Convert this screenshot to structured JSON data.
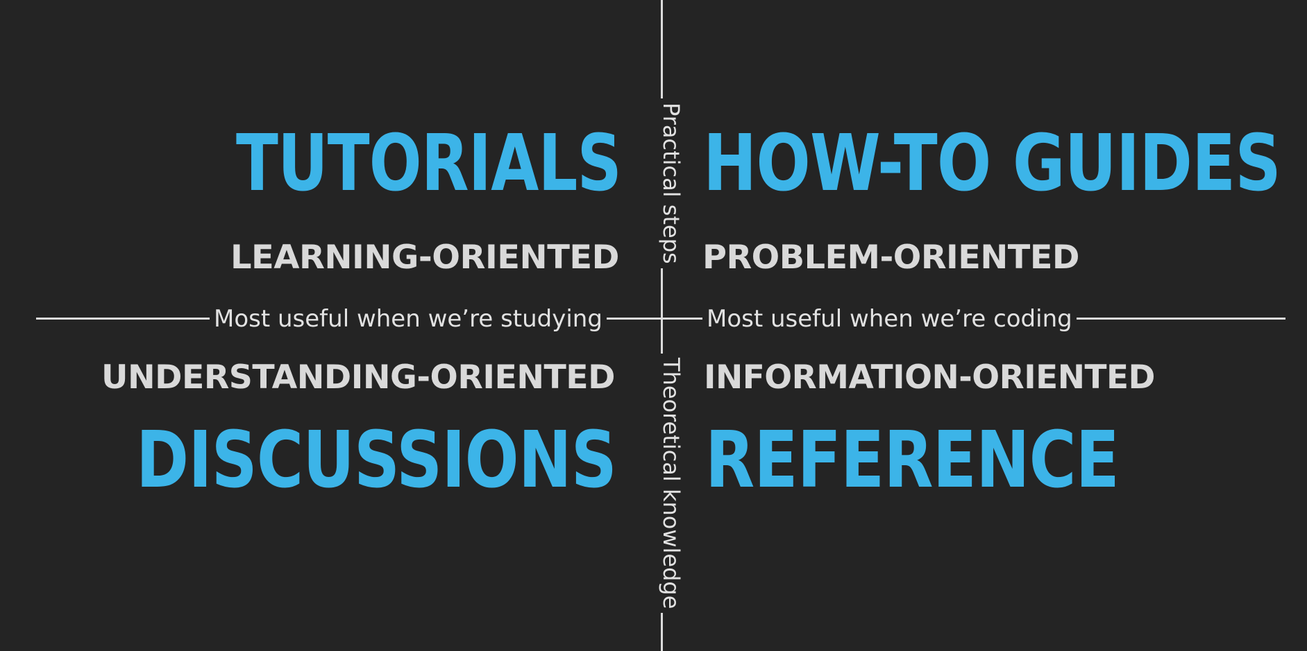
{
  "quadrants": {
    "top_left": {
      "title": "TUTORIALS",
      "subtitle": "LEARNING-ORIENTED"
    },
    "top_right": {
      "title": "HOW-TO GUIDES",
      "subtitle": "PROBLEM-ORIENTED"
    },
    "bottom_left": {
      "title": "DISCUSSIONS",
      "subtitle": "UNDERSTANDING-ORIENTED"
    },
    "bottom_right": {
      "title": "REFERENCE",
      "subtitle": "INFORMATION-ORIENTED"
    }
  },
  "axes": {
    "vertical_top": "Practical steps",
    "vertical_bottom": "Theoretical knowledge",
    "horizontal_left": "Most useful when we’re studying",
    "horizontal_right": "Most useful when we’re coding"
  },
  "colors": {
    "background": "#242424",
    "title": "#3cb4e8",
    "subtitle": "#d9d9d9",
    "axis": "#dcdcdc"
  }
}
